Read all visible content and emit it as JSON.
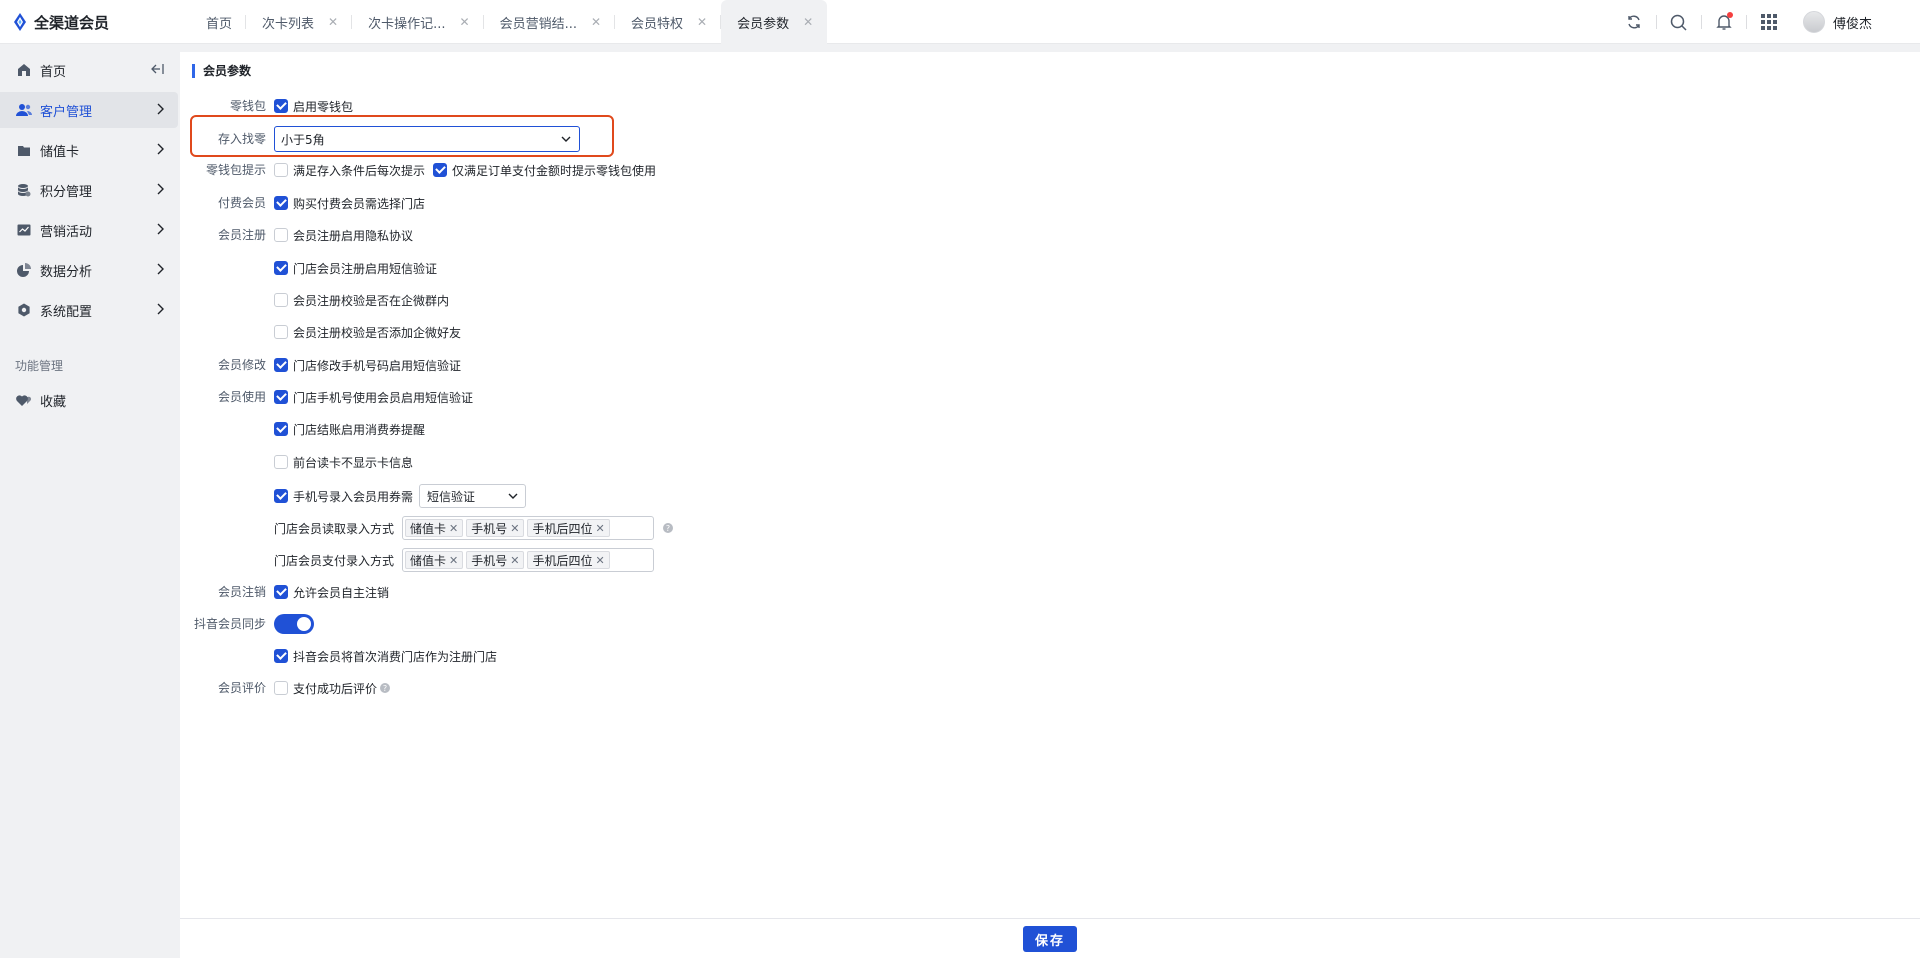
{
  "app": {
    "name": "全渠道会员"
  },
  "tabs": [
    {
      "label": "首页",
      "closable": false
    },
    {
      "label": "次卡列表",
      "closable": true
    },
    {
      "label": "次卡操作记...",
      "closable": true
    },
    {
      "label": "会员营销结...",
      "closable": true
    },
    {
      "label": "会员特权",
      "closable": true
    },
    {
      "label": "会员参数",
      "closable": true,
      "active": true
    }
  ],
  "user": {
    "name": "傅俊杰"
  },
  "sidebar": {
    "items": [
      {
        "label": "首页",
        "icon": "home-icon"
      },
      {
        "label": "客户管理",
        "icon": "users-icon",
        "active": true
      },
      {
        "label": "储值卡",
        "icon": "card-icon"
      },
      {
        "label": "积分管理",
        "icon": "points-icon"
      },
      {
        "label": "营销活动",
        "icon": "chart-line-icon"
      },
      {
        "label": "数据分析",
        "icon": "pie-chart-icon"
      },
      {
        "label": "系统配置",
        "icon": "settings-icon"
      }
    ],
    "group_label": "功能管理",
    "favorites_label": "收藏"
  },
  "main": {
    "section_title": "会员参数",
    "wallet_label": "零钱包",
    "wallet_enable": "启用零钱包",
    "change_label": "存入找零",
    "change_value": "小于5角",
    "wallet_tip_label": "零钱包提示",
    "wallet_tip_1": "满足存入条件后每次提示",
    "wallet_tip_2": "仅满足订单支付金额时提示零钱包使用",
    "paid_label": "付费会员",
    "paid_1": "购买付费会员需选择门店",
    "register_label": "会员注册",
    "register_1": "会员注册启用隐私协议",
    "register_2": "门店会员注册启用短信验证",
    "register_3": "会员注册校验是否在企微群内",
    "register_4": "会员注册校验是否添加企微好友",
    "modify_label": "会员修改",
    "modify_1": "门店修改手机号码启用短信验证",
    "use_label": "会员使用",
    "use_1": "门店手机号使用会员启用短信验证",
    "use_2": "门店结账启用消费券提醒",
    "use_3": "前台读卡不显示卡信息",
    "use_4": "手机号录入会员用券需",
    "use_4_select": "短信验证",
    "read_method_label": "门店会员读取录入方式",
    "pay_method_label": "门店会员支付录入方式",
    "method_tags": [
      "储值卡",
      "手机号",
      "手机后四位"
    ],
    "cancel_label": "会员注销",
    "cancel_1": "允许会员自主注销",
    "douyin_label": "抖音会员同步",
    "douyin_1": "抖音会员将首次消费门店作为注册门店",
    "review_label": "会员评价",
    "review_1": "支付成功后评价",
    "help_glyph": "?"
  },
  "footer": {
    "save_label": "保存"
  },
  "colors": {
    "primary": "#2051d6",
    "highlight": "#e0491c"
  }
}
